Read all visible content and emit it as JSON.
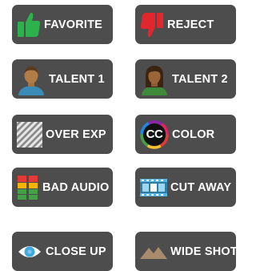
{
  "buttons": {
    "favorite": {
      "label": "FAVORITE",
      "icon": "thumbs-up-icon",
      "color": "#2bb24c"
    },
    "reject": {
      "label": "REJECT",
      "icon": "thumbs-down-icon",
      "color": "#e1262d"
    },
    "talent1": {
      "label": "TALENT 1",
      "icon": "person-icon"
    },
    "talent2": {
      "label": "TALENT 2",
      "icon": "person-icon"
    },
    "over_exp": {
      "label": "OVER EXP",
      "icon": "overexposure-stripes-icon"
    },
    "color": {
      "label": "COLOR",
      "icon": "cc-color-ring-icon",
      "badge": "CC"
    },
    "bad_audio": {
      "label": "BAD AUDIO",
      "icon": "audio-meter-icon"
    },
    "cut_away": {
      "label": "CUT AWAY",
      "icon": "film-strip-icon"
    },
    "close_up": {
      "label": "CLOSE UP",
      "icon": "eye-icon",
      "color": "#3fa9e0"
    },
    "wide_shot": {
      "label": "WIDE SHOT",
      "icon": "mountains-icon",
      "color": "#a88b6d"
    }
  }
}
